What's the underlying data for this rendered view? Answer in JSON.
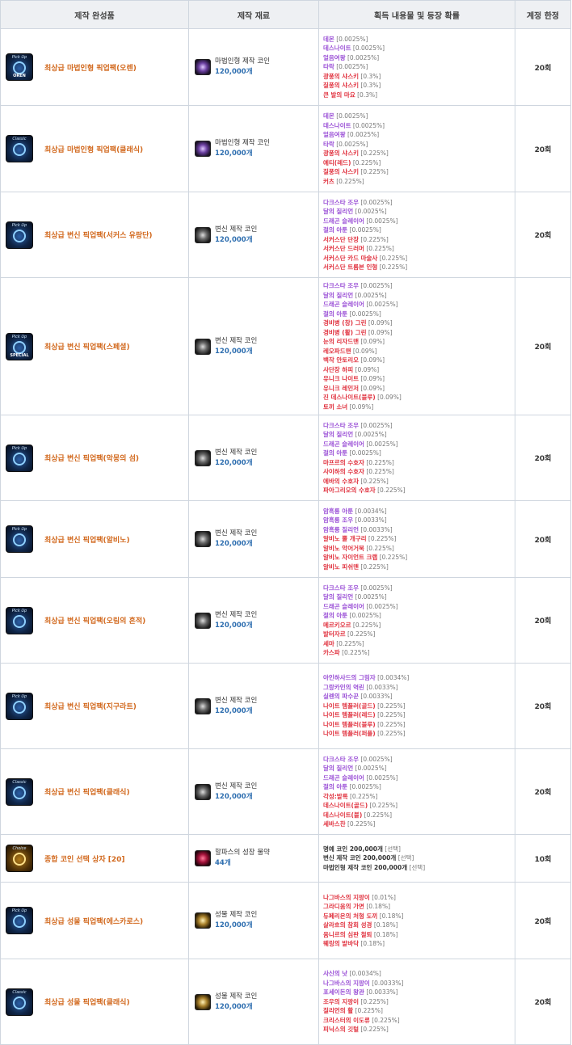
{
  "headers": {
    "product": "제작 완성품",
    "material": "제작 재료",
    "items": "획득 내용물 및 등장 확률",
    "limit": "계정 한정"
  },
  "colors": {
    "product_name": "#d2691e",
    "purple_item": "#9a4fd6",
    "red_item": "#e0323f",
    "quantity": "#2f6fb0"
  },
  "rows": [
    {
      "product": "최상급 마법인형 픽업팩(오렌)",
      "icon": "pickup-oren-icon",
      "icon_top": "Pick Up",
      "icon_bottom": "OREN",
      "material": "마법인형 제작 코인",
      "material_icon": "doll-coin-icon",
      "qty": "120,000개",
      "limit": "20회",
      "items": [
        {
          "name": "데몬",
          "prob": "[0.0025%]",
          "color": "purple"
        },
        {
          "name": "데스나이트",
          "prob": "[0.0025%]",
          "color": "purple"
        },
        {
          "name": "얼음여왕",
          "prob": "[0.0025%]",
          "color": "purple"
        },
        {
          "name": "타락",
          "prob": "[0.0025%]",
          "color": "purple"
        },
        {
          "name": "광풍의 샤스키",
          "prob": "[0.3%]",
          "color": "red"
        },
        {
          "name": "질풍의 샤스키",
          "prob": "[0.3%]",
          "color": "red"
        },
        {
          "name": "큰 발의 마요",
          "prob": "[0.3%]",
          "color": "red"
        }
      ]
    },
    {
      "product": "최상급 마법인형 픽업팩(클래식)",
      "icon": "classic-icon",
      "icon_top": "Classic",
      "icon_bottom": "",
      "material": "마법인형 제작 코인",
      "material_icon": "doll-coin-icon",
      "qty": "120,000개",
      "limit": "20회",
      "items": [
        {
          "name": "데몬",
          "prob": "[0.0025%]",
          "color": "purple"
        },
        {
          "name": "데스나이트",
          "prob": "[0.0025%]",
          "color": "purple"
        },
        {
          "name": "얼음여왕",
          "prob": "[0.0025%]",
          "color": "purple"
        },
        {
          "name": "타락",
          "prob": "[0.0025%]",
          "color": "purple"
        },
        {
          "name": "광풍의 샤스키",
          "prob": "[0.225%]",
          "color": "red"
        },
        {
          "name": "예티(레드)",
          "prob": "[0.225%]",
          "color": "red"
        },
        {
          "name": "질풍의 샤스키",
          "prob": "[0.225%]",
          "color": "red"
        },
        {
          "name": "커츠",
          "prob": "[0.225%]",
          "color": "red"
        }
      ]
    },
    {
      "product": "최상급 변신 픽업팩(서커스 유랑단)",
      "icon": "pickup-circus-icon",
      "icon_top": "Pick Up",
      "icon_bottom": "",
      "material": "변신 제작 코인",
      "material_icon": "polymorph-coin-icon",
      "qty": "120,000개",
      "limit": "20회",
      "items": [
        {
          "name": "다크스타 조우",
          "prob": "[0.0025%]",
          "color": "purple"
        },
        {
          "name": "달의 질리언",
          "prob": "[0.0025%]",
          "color": "purple"
        },
        {
          "name": "드래곤 슬레이어",
          "prob": "[0.0025%]",
          "color": "purple"
        },
        {
          "name": "절의 아툰",
          "prob": "[0.0025%]",
          "color": "purple"
        },
        {
          "name": "서커스단 단장",
          "prob": "[0.225%]",
          "color": "red"
        },
        {
          "name": "서커스단 드러머",
          "prob": "[0.225%]",
          "color": "red"
        },
        {
          "name": "서커스단 카드 마술사",
          "prob": "[0.225%]",
          "color": "red"
        },
        {
          "name": "서커스단 트롬본 인형",
          "prob": "[0.225%]",
          "color": "red"
        }
      ]
    },
    {
      "product": "최상급 변신 픽업팩(스페셜)",
      "icon": "pickup-special-icon",
      "icon_top": "Pick Up",
      "icon_bottom": "SPECIAL",
      "material": "변신 제작 코인",
      "material_icon": "polymorph-coin-icon",
      "qty": "120,000개",
      "limit": "20회",
      "items": [
        {
          "name": "다크스타 조우",
          "prob": "[0.0025%]",
          "color": "purple"
        },
        {
          "name": "달의 질리언",
          "prob": "[0.0025%]",
          "color": "purple"
        },
        {
          "name": "드래곤 슬레이어",
          "prob": "[0.0025%]",
          "color": "purple"
        },
        {
          "name": "절의 아툰",
          "prob": "[0.0025%]",
          "color": "purple"
        },
        {
          "name": "경비병 (창) 그린",
          "prob": "[0.09%]",
          "color": "red"
        },
        {
          "name": "경비병 (활) 그린",
          "prob": "[0.09%]",
          "color": "red"
        },
        {
          "name": "눈의 리자드맨",
          "prob": "[0.09%]",
          "color": "red"
        },
        {
          "name": "레오파드맨",
          "prob": "[0.09%]",
          "color": "red"
        },
        {
          "name": "백작 안토리오",
          "prob": "[0.09%]",
          "color": "red"
        },
        {
          "name": "사단장 하피",
          "prob": "[0.09%]",
          "color": "red"
        },
        {
          "name": "유니크 나이트",
          "prob": "[0.09%]",
          "color": "red"
        },
        {
          "name": "유니크 레인저",
          "prob": "[0.09%]",
          "color": "red"
        },
        {
          "name": "진 데스나이트(블루)",
          "prob": "[0.09%]",
          "color": "red"
        },
        {
          "name": "토끼 소녀",
          "prob": "[0.09%]",
          "color": "red"
        }
      ]
    },
    {
      "product": "최상급 변신 픽업팩(악몽의 섬)",
      "icon": "pickup-nightmare-icon",
      "icon_top": "Pick Up",
      "icon_bottom": "",
      "material": "변신 제작 코인",
      "material_icon": "polymorph-coin-icon",
      "qty": "120,000개",
      "limit": "20회",
      "items": [
        {
          "name": "다크스타 조우",
          "prob": "[0.0025%]",
          "color": "purple"
        },
        {
          "name": "달의 질리언",
          "prob": "[0.0025%]",
          "color": "purple"
        },
        {
          "name": "드래곤 슬레이어",
          "prob": "[0.0025%]",
          "color": "purple"
        },
        {
          "name": "절의 아툰",
          "prob": "[0.0025%]",
          "color": "purple"
        },
        {
          "name": "마프르의 수호자",
          "prob": "[0.225%]",
          "color": "red"
        },
        {
          "name": "사이하의 수호자",
          "prob": "[0.225%]",
          "color": "red"
        },
        {
          "name": "에바의 수호자",
          "prob": "[0.225%]",
          "color": "red"
        },
        {
          "name": "파아그리오의 수호자",
          "prob": "[0.225%]",
          "color": "red"
        }
      ]
    },
    {
      "product": "최상급 변신 픽업팩(알비노)",
      "icon": "pickup-albino-icon",
      "icon_top": "Pick Up",
      "icon_bottom": "",
      "material": "변신 제작 코인",
      "material_icon": "polymorph-coin-icon",
      "qty": "120,000개",
      "limit": "20회",
      "items": [
        {
          "name": "암흑룡 아툰",
          "prob": "[0.0034%]",
          "color": "purple"
        },
        {
          "name": "암흑룡 조우",
          "prob": "[0.0033%]",
          "color": "purple"
        },
        {
          "name": "암흑룡 질리언",
          "prob": "[0.0033%]",
          "color": "purple"
        },
        {
          "name": "알비노 뿔 개구리",
          "prob": "[0.225%]",
          "color": "red"
        },
        {
          "name": "알비노 악어거북",
          "prob": "[0.225%]",
          "color": "red"
        },
        {
          "name": "알비노 자이언트 크랩",
          "prob": "[0.225%]",
          "color": "red"
        },
        {
          "name": "알비노 피쉬맨",
          "prob": "[0.225%]",
          "color": "red"
        }
      ]
    },
    {
      "product": "최상급 변신 픽업팩(오림의 흔적)",
      "icon": "pickup-orim-icon",
      "icon_top": "Pick Up",
      "icon_bottom": "",
      "material": "변신 제작 코인",
      "material_icon": "polymorph-coin-icon",
      "qty": "120,000개",
      "limit": "20회",
      "items": [
        {
          "name": "다크스타 조우",
          "prob": "[0.0025%]",
          "color": "purple"
        },
        {
          "name": "달의 질리언",
          "prob": "[0.0025%]",
          "color": "purple"
        },
        {
          "name": "드래곤 슬레이어",
          "prob": "[0.0025%]",
          "color": "purple"
        },
        {
          "name": "절의 아툰",
          "prob": "[0.0025%]",
          "color": "purple"
        },
        {
          "name": "메르키오르",
          "prob": "[0.225%]",
          "color": "red"
        },
        {
          "name": "발터자르",
          "prob": "[0.225%]",
          "color": "red"
        },
        {
          "name": "세마",
          "prob": "[0.225%]",
          "color": "red"
        },
        {
          "name": "카스파",
          "prob": "[0.225%]",
          "color": "red"
        }
      ]
    },
    {
      "product": "최상급 변신 픽업팩(지구라트)",
      "icon": "pickup-ziggurat-icon",
      "icon_top": "Pick Up",
      "icon_bottom": "",
      "material": "변신 제작 코인",
      "material_icon": "polymorph-coin-icon",
      "qty": "120,000개",
      "limit": "20회",
      "items": [
        {
          "name": "아인하사드의 그림자",
          "prob": "[0.0034%]",
          "color": "purple"
        },
        {
          "name": "그랑카인의 역린",
          "prob": "[0.0033%]",
          "color": "purple"
        },
        {
          "name": "실렌의 파수꾼",
          "prob": "[0.0033%]",
          "color": "purple"
        },
        {
          "name": "나이트 템플러(골드)",
          "prob": "[0.225%]",
          "color": "red"
        },
        {
          "name": "나이트 템플러(레드)",
          "prob": "[0.225%]",
          "color": "red"
        },
        {
          "name": "나이트 템플러(블루)",
          "prob": "[0.225%]",
          "color": "red"
        },
        {
          "name": "나이트 템플러(퍼플)",
          "prob": "[0.225%]",
          "color": "red"
        }
      ]
    },
    {
      "product": "최상급 변신 픽업팩(클래식)",
      "icon": "classic-icon",
      "icon_top": "Classic",
      "icon_bottom": "",
      "material": "변신 제작 코인",
      "material_icon": "polymorph-coin-icon",
      "qty": "120,000개",
      "limit": "20회",
      "items": [
        {
          "name": "다크스타 조우",
          "prob": "[0.0025%]",
          "color": "purple"
        },
        {
          "name": "달의 질리언",
          "prob": "[0.0025%]",
          "color": "purple"
        },
        {
          "name": "드래곤 슬레이어",
          "prob": "[0.0025%]",
          "color": "purple"
        },
        {
          "name": "절의 아툰",
          "prob": "[0.0025%]",
          "color": "purple"
        },
        {
          "name": "각성:발록",
          "prob": "[0.225%]",
          "color": "red"
        },
        {
          "name": "데스나이트(골드)",
          "prob": "[0.225%]",
          "color": "red"
        },
        {
          "name": "데스나이트(블)",
          "prob": "[0.225%]",
          "color": "red"
        },
        {
          "name": "세바스찬",
          "prob": "[0.225%]",
          "color": "red"
        }
      ]
    },
    {
      "product": "종합 코인 선택 상자 [20]",
      "icon": "choice-box-icon",
      "icon_top": "Choice",
      "icon_bottom": "",
      "gold": true,
      "material": "할파스의 성장 물약",
      "material_icon": "halphas-potion-icon",
      "material_red": true,
      "qty": "44개",
      "limit": "10회",
      "items": [
        {
          "name": "명예 코인 200,000개",
          "prob": "[선택]",
          "color": "dark"
        },
        {
          "name": "변신 제작 코인 200,000개",
          "prob": "[선택]",
          "color": "dark"
        },
        {
          "name": "마법인형 제작 코인 200,000개",
          "prob": "[선택]",
          "color": "dark"
        }
      ]
    },
    {
      "product": "최상급 성물 픽업팩(에스카로스)",
      "icon": "pickup-escaros-icon",
      "icon_top": "Pick Up",
      "icon_bottom": "",
      "material": "성물 제작 코인",
      "material_icon": "relic-coin-icon",
      "material_gold": true,
      "qty": "120,000개",
      "limit": "20회",
      "items": [
        {
          "name": "나그바스의 지팡이",
          "prob": "[0.01%]",
          "color": "red"
        },
        {
          "name": "그라디움의 가면",
          "prob": "[0.18%]",
          "color": "red"
        },
        {
          "name": "듀페리온의 처형 도끼",
          "prob": "[0.18%]",
          "color": "red"
        },
        {
          "name": "살라흐의 참회 성경",
          "prob": "[0.18%]",
          "color": "red"
        },
        {
          "name": "움니르의 심판 철퇴",
          "prob": "[0.18%]",
          "color": "red"
        },
        {
          "name": "웨링의 발바닥",
          "prob": "[0.18%]",
          "color": "red"
        }
      ]
    },
    {
      "product": "최상급 성물 픽업팩(클래식)",
      "icon": "classic-icon",
      "icon_top": "Classic",
      "icon_bottom": "",
      "material": "성물 제작 코인",
      "material_icon": "relic-coin-icon",
      "material_gold": true,
      "qty": "120,000개",
      "limit": "20회",
      "items": [
        {
          "name": "사신의 낫",
          "prob": "[0.0034%]",
          "color": "purple"
        },
        {
          "name": "나그바스의 지팡이",
          "prob": "[0.0033%]",
          "color": "purple"
        },
        {
          "name": "포세이돈의 왕관",
          "prob": "[0.0033%]",
          "color": "purple"
        },
        {
          "name": "조우의 지팡이",
          "prob": "[0.225%]",
          "color": "red"
        },
        {
          "name": "질리언의 활",
          "prob": "[0.225%]",
          "color": "red"
        },
        {
          "name": "크리스터의 이도류",
          "prob": "[0.225%]",
          "color": "red"
        },
        {
          "name": "피닉스의 깃털",
          "prob": "[0.225%]",
          "color": "red"
        }
      ]
    }
  ]
}
